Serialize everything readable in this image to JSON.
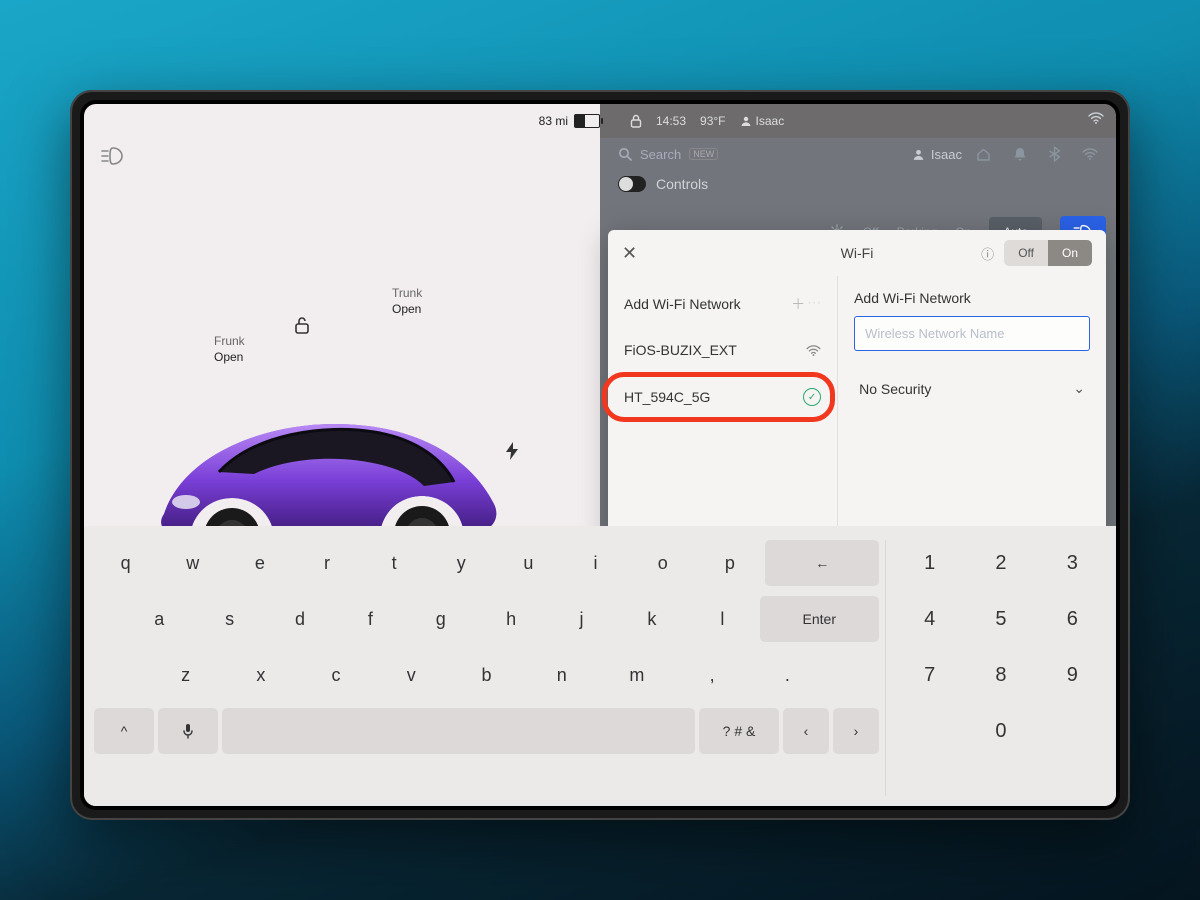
{
  "status": {
    "range": "83 mi",
    "time": "14:53",
    "temp": "93°F",
    "user": "Isaac"
  },
  "car": {
    "frunk_label": "Frunk",
    "frunk_action": "Open",
    "trunk_label": "Trunk",
    "trunk_action": "Open"
  },
  "search": {
    "label": "Search",
    "badge": "NEW",
    "profile": "Isaac"
  },
  "controls": {
    "label": "Controls",
    "off": "Off",
    "parking": "Parking",
    "on": "On",
    "auto": "Auto"
  },
  "wifi": {
    "title": "Wi-Fi",
    "off": "Off",
    "on": "On",
    "add_label": "Add Wi-Fi Network",
    "form_title": "Add Wi-Fi Network",
    "placeholder": "Wireless Network Name",
    "security": "No Security",
    "networks": [
      {
        "name": "FiOS-BUZIX_EXT"
      },
      {
        "name": "HT_594C_5G"
      }
    ]
  },
  "keyboard": {
    "rows": [
      [
        "q",
        "w",
        "e",
        "r",
        "t",
        "y",
        "u",
        "i",
        "o",
        "p"
      ],
      [
        "a",
        "s",
        "d",
        "f",
        "g",
        "h",
        "j",
        "k",
        "l"
      ],
      [
        "z",
        "x",
        "c",
        "v",
        "b",
        "n",
        "m",
        ",",
        "."
      ]
    ],
    "backspace": "←",
    "enter": "Enter",
    "shift": "^",
    "symbols": "? # &",
    "left": "‹",
    "right": "›",
    "nums": [
      [
        "1",
        "2",
        "3"
      ],
      [
        "4",
        "5",
        "6"
      ],
      [
        "7",
        "8",
        "9"
      ],
      [
        "",
        "0",
        ""
      ]
    ]
  }
}
